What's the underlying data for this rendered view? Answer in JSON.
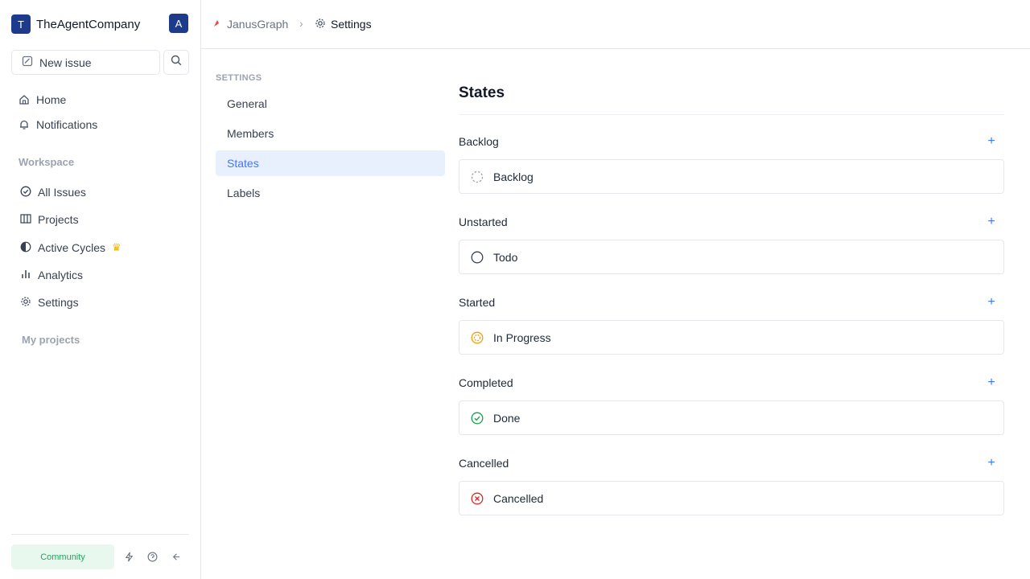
{
  "workspace": {
    "logo_letter": "T",
    "name": "TheAgentCompany",
    "avatar_letter": "A"
  },
  "sidebar": {
    "new_issue_label": "New issue",
    "home_label": "Home",
    "notifications_label": "Notifications",
    "workspace_section": "Workspace",
    "items": [
      {
        "label": "All Issues",
        "icon": "check-circle-icon"
      },
      {
        "label": "Projects",
        "icon": "projects-board-icon"
      },
      {
        "label": "Active Cycles",
        "icon": "contrast-icon"
      },
      {
        "label": "Analytics",
        "icon": "bar-chart-icon"
      },
      {
        "label": "Settings",
        "icon": "gear-icon"
      }
    ],
    "my_projects_label": "My projects",
    "community_label": "Community"
  },
  "breadcrumb": {
    "project": "JanusGraph",
    "current": "Settings"
  },
  "settings_nav": {
    "section_label": "SETTINGS",
    "items": [
      {
        "label": "General"
      },
      {
        "label": "Members"
      },
      {
        "label": "States"
      },
      {
        "label": "Labels"
      }
    ]
  },
  "page": {
    "title": "States"
  },
  "state_groups": [
    {
      "name": "Backlog",
      "state": "Backlog",
      "color": "#9ca3af"
    },
    {
      "name": "Unstarted",
      "state": "Todo",
      "color": "#374151"
    },
    {
      "name": "Started",
      "state": "In Progress",
      "color": "#f59e0b"
    },
    {
      "name": "Completed",
      "state": "Done",
      "color": "#16a34a"
    },
    {
      "name": "Cancelled",
      "state": "Cancelled",
      "color": "#dc2626"
    }
  ],
  "colors": {
    "accent": "#3f76ff",
    "brand": "#1e3a8a"
  }
}
